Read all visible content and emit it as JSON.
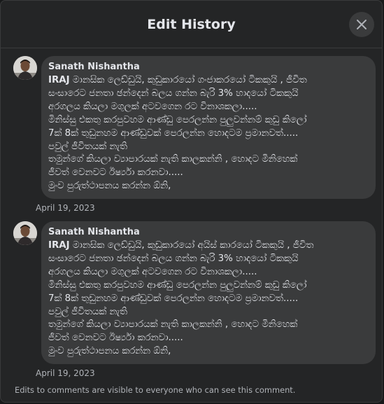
{
  "dialog": {
    "title": "Edit History",
    "footer_note": "Edits to comments are visible to everyone who can see this comment."
  },
  "entries": [
    {
      "author": "Sanath Nishantha",
      "date": "April 19, 2023",
      "first_word": "IRAJ",
      "lines": [
        "මානසික ලෙඩ්ඩුයි, කුඩුකාරයෝ ගංජාකරයෝ ටිකකුයි , ජීවිත",
        "සංසාරෙට ජනතා ඡන්දෙන් බලය ගන්න බැරි 3% හාදයෝ ටිකකුයි",
        "අරගලය කියලා මගුලක් අටවගෙන රට විනාශකලා.....",
        "මිනිස්සු එකතු කරපුවහම ආණ්ඩු පෙරලන්න පුලුවන්නම් කුඩු කිලෝ",
        "7ක් 8ක් තුඩුනහම ආණ්ඩුවක් පෙරලන්න හොදටම ප්‍රමානවත්.....",
        "පවුල් ජීවිතයක් නැති",
        "තමුන්ගේ කියලා ව්‍යාපාරයක් නැති කාලකන්නි , හොදට මිනිහෙක්",
        "ජීවත් වෙනවට ඊර්ෂ්‍යා කරනවා.....",
        "මුංව පුරුත්ථාපනය කරන්න ඕනි,"
      ]
    },
    {
      "author": "Sanath Nishantha",
      "date": "April 19, 2023",
      "first_word": "IRAJ",
      "lines": [
        "මානසික ලෙඩ්ඩුයි, කුඩුකාරයෝ අයිස් කාරයෝ ටිකකුයි , ජීවිත",
        "සංසාරෙට ජනතා ඡන්දෙන් බලය ගන්න බැරි 3% හාදයෝ ටිකකුයි",
        "අරගලය කියලා මගුලක් අටවගෙන රට විනාශකලා.....",
        "මිනිස්සු එකතු කරපුවහම ආණ්ඩු පෙරලන්න පුලුවන්නම් කුඩු කිලෝ",
        "7ක් 8ක් තුඩුනහම ආණ්ඩුවක් පෙරලන්න හොදටම ප්‍රමානවත්.....",
        "පවුල් ජීවිතයක් නැති",
        "තමුන්ගේ කියලා ව්‍යාපාරයක් නැති කාලකන්නි , හොදට මිනිහෙක්",
        "ජීවත් වෙනවට ඊර්ෂ්‍යා කරනවා.....",
        "මුංව පුරුත්ථාපනය කරන්න ඕනි,"
      ]
    }
  ],
  "icons": {
    "close": "close-icon",
    "avatar": "profile-photo"
  },
  "colors": {
    "background": "#242526",
    "bubble": "#3a3b3c",
    "primary_text": "#e4e6eb",
    "secondary_text": "#b0b3b8"
  }
}
